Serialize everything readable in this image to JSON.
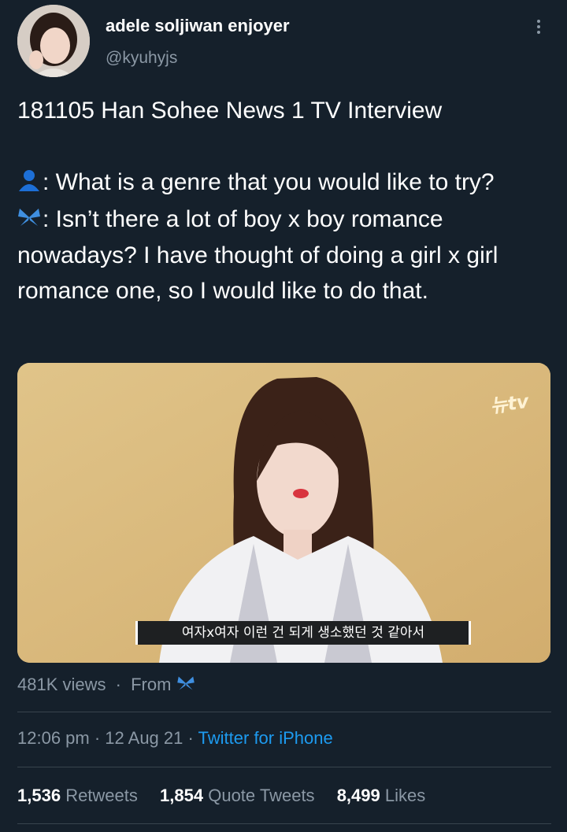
{
  "user": {
    "display_name": "adele soljiwan enjoyer",
    "handle": "@kyuhyjs"
  },
  "tweet": {
    "title_line": "181105 Han Sohee News 1 TV Interview",
    "question": ": What is a genre that you would like to try?",
    "answer": ": Isn’t there a lot of boy x boy romance nowadays? I have thought of doing a girl x girl romance one, so I would like to do that."
  },
  "media": {
    "caption": "여자x여자 이런 건 되게 생소했던 것 같아서",
    "logo": "뉴tv"
  },
  "views": {
    "count": "481K views",
    "separator": "·",
    "from": "From"
  },
  "meta": {
    "time": "12:06 pm · 12 Aug 21 ·",
    "source": "Twitter for iPhone"
  },
  "stats": [
    {
      "num": "1,536",
      "label": "Retweets"
    },
    {
      "num": "1,854",
      "label": "Quote Tweets"
    },
    {
      "num": "8,499",
      "label": "Likes"
    }
  ],
  "icons": {
    "person": "bust-silhouette-icon",
    "butterfly": "butterfly-icon",
    "more": "more-vertical-icon"
  },
  "colors": {
    "background": "#15202b",
    "secondary_text": "#8b98a5",
    "link": "#1d9bf0",
    "divider": "#38444d"
  }
}
